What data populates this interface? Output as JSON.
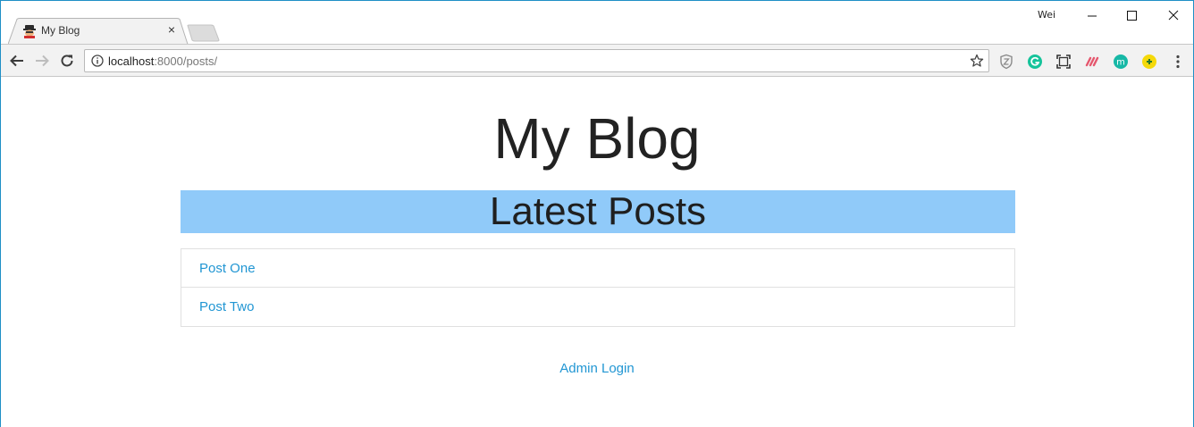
{
  "browser": {
    "tab_title": "My Blog",
    "tab_close": "×",
    "user_name": "Wei",
    "url_host": "localhost",
    "url_path": ":8000/posts/",
    "extensions": [
      "shield-icon",
      "grammarly-icon",
      "screenshot-icon",
      "toggl-icon",
      "m-extension-icon",
      "yellow-extension-icon"
    ]
  },
  "page": {
    "site_title": "My Blog",
    "section_heading": "Latest Posts",
    "posts": [
      {
        "title": "Post One"
      },
      {
        "title": "Post Two"
      }
    ],
    "admin_login": "Admin Login"
  },
  "colors": {
    "heading_bg": "#90caf9",
    "link": "#2196d3",
    "window_border": "#1f8fc6"
  }
}
